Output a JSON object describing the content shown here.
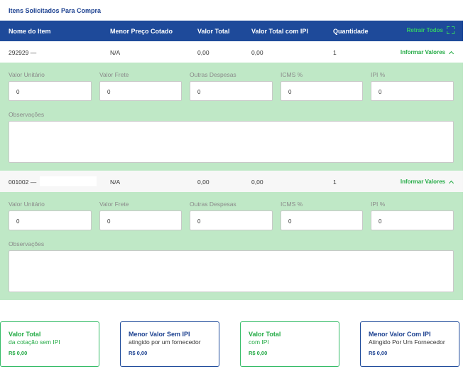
{
  "card": {
    "title": "Itens Solicitados Para Compra"
  },
  "header": {
    "columns": [
      "Nome do Item",
      "Menor Preço Cotado",
      "Valor Total",
      "Valor Total com IPI",
      "Quantidade"
    ],
    "collapse_all": "Retrair Todos",
    "colors": {
      "background": "#1e4a9a",
      "action": "#33cc66"
    }
  },
  "items": [
    {
      "code": "292929 —",
      "lowest_price": "N/A",
      "total": "0,00",
      "total_ipi": "0,00",
      "quantity": "1",
      "action": "Informar Valores",
      "fields": [
        {
          "label": "Valor Unitário",
          "value": "0"
        },
        {
          "label": "Valor Frete",
          "value": "0"
        },
        {
          "label": "Outras Despesas",
          "value": "0"
        },
        {
          "label": "ICMS %",
          "value": "0"
        },
        {
          "label": "IPI %",
          "value": "0"
        }
      ],
      "notes_label": "Observações"
    },
    {
      "code": "001002 —",
      "lowest_price": "N/A",
      "total": "0,00",
      "total_ipi": "0,00",
      "quantity": "1",
      "action": "Informar Valores",
      "fields": [
        {
          "label": "Valor Unitário",
          "value": "0"
        },
        {
          "label": "Valor Frete",
          "value": "0"
        },
        {
          "label": "Outras Despesas",
          "value": "0"
        },
        {
          "label": "ICMS %",
          "value": "0"
        },
        {
          "label": "IPI %",
          "value": "0"
        }
      ],
      "notes_label": "Observações"
    }
  ],
  "summaries": [
    {
      "title": "Valor Total",
      "subtitle": "da cotação sem IPI",
      "value": "R$ 0,00"
    },
    {
      "title": "Menor Valor Sem IPI",
      "subtitle": "atingido por um fornecedor",
      "value": "R$ 0,00"
    },
    {
      "title": "Valor Total",
      "subtitle": "com IPI",
      "value": "R$ 0,00"
    },
    {
      "title": "Menor Valor Com IPI",
      "subtitle": "Atingido Por Um Fornecedor",
      "value": "R$ 0,00"
    }
  ],
  "colors": {
    "panel": "#bfe8c6",
    "green": "#22aa44",
    "blue": "#1a3f8f"
  }
}
